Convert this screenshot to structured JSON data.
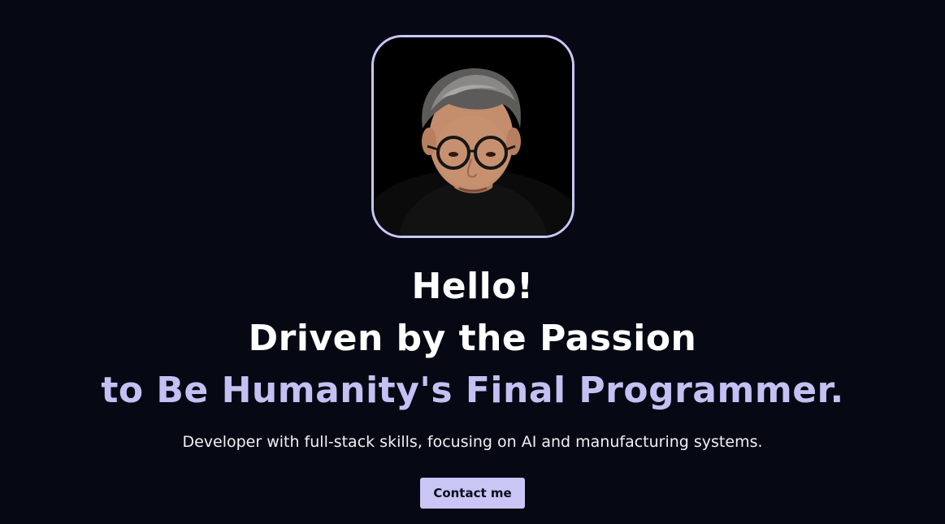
{
  "hero": {
    "greeting": "Hello!",
    "headline_line2": "Driven by the Passion",
    "headline_line3": "to Be Humanity's Final Programmer.",
    "subtitle": "Developer with full-stack skills, focusing on AI and manufacturing systems.",
    "contact_label": "Contact me"
  },
  "colors": {
    "background": "#060913",
    "accent": "#c9c6f5",
    "accent_text": "#c3c1f3",
    "headline": "#ffffff"
  }
}
